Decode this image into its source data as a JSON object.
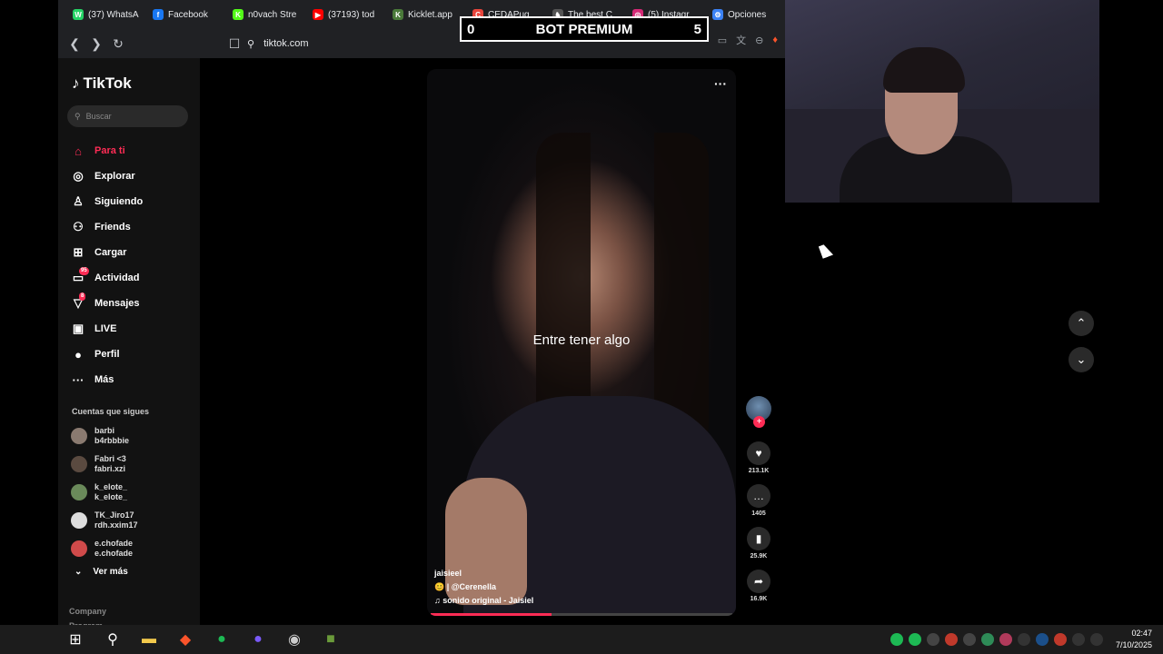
{
  "browser": {
    "tabs": [
      {
        "label": "(37) WhatsA",
        "color": "#25d366",
        "glyph": "W"
      },
      {
        "label": "Facebook",
        "color": "#1877f2",
        "glyph": "f"
      },
      {
        "label": "n0vach Stre",
        "color": "#53fc18",
        "glyph": "K"
      },
      {
        "label": "(37193) tod",
        "color": "#ff0000",
        "glyph": "▶"
      },
      {
        "label": "Kicklet.app",
        "color": "#4a7a3a",
        "glyph": "K"
      },
      {
        "label": "CEDAPug",
        "color": "#e8453c",
        "glyph": "C"
      },
      {
        "label": "The best C",
        "color": "#555555",
        "glyph": "♞"
      },
      {
        "label": "(5) Instagr",
        "color": "#d62976",
        "glyph": "◎"
      },
      {
        "label": "Opciones",
        "color": "#3b82f6",
        "glyph": "⚙"
      }
    ],
    "url": "tiktok.com"
  },
  "overlay": {
    "left_score": "0",
    "title": "BOT PREMIUM",
    "right_score": "5"
  },
  "tiktok": {
    "logo": "TikTok",
    "search_placeholder": "Buscar",
    "nav": [
      {
        "label": "Para ti",
        "icon": "home-icon",
        "glyph": "⌂",
        "active": true,
        "badge": ""
      },
      {
        "label": "Explorar",
        "icon": "compass-icon",
        "glyph": "◎",
        "active": false,
        "badge": ""
      },
      {
        "label": "Siguiendo",
        "icon": "following-icon",
        "glyph": "♙",
        "active": false,
        "badge": ""
      },
      {
        "label": "Friends",
        "icon": "friends-icon",
        "glyph": "⚇",
        "active": false,
        "badge": ""
      },
      {
        "label": "Cargar",
        "icon": "upload-icon",
        "glyph": "⊞",
        "active": false,
        "badge": ""
      },
      {
        "label": "Actividad",
        "icon": "activity-icon",
        "glyph": "▭",
        "active": false,
        "badge": "95"
      },
      {
        "label": "Mensajes",
        "icon": "messages-icon",
        "glyph": "▽",
        "active": false,
        "badge": "8"
      },
      {
        "label": "LIVE",
        "icon": "live-icon",
        "glyph": "▣",
        "active": false,
        "badge": ""
      },
      {
        "label": "Perfil",
        "icon": "profile-icon",
        "glyph": "●",
        "active": false,
        "badge": ""
      },
      {
        "label": "Más",
        "icon": "more-icon",
        "glyph": "···",
        "active": false,
        "badge": ""
      }
    ],
    "following_title": "Cuentas que sigues",
    "following": [
      {
        "name": "barbi",
        "handle": "b4rbbbie",
        "color": "#8a7a70"
      },
      {
        "name": "Fabri <3",
        "handle": "fabri.xzi",
        "color": "#5a4a40"
      },
      {
        "name": "k_elote_",
        "handle": "k_elote_",
        "color": "#6a8a5a"
      },
      {
        "name": "TK_Jiro17",
        "handle": "rdh.xxim17",
        "color": "#dddddd"
      },
      {
        "name": "e.chofade",
        "handle": "e.chofade",
        "color": "#d04a4a"
      }
    ],
    "see_more": "Ver más",
    "company": "Company",
    "program": "Program"
  },
  "video": {
    "caption": "Entre tener algo",
    "author": "jaisieel",
    "description": "| @Cerenella",
    "sound": "sonido original - Jaisiel",
    "progress": 0.4,
    "likes": "213.1K",
    "comments": "1405",
    "saves": "25.9K",
    "shares": "16.9K"
  },
  "taskbar": {
    "time": "02:47",
    "date": "7/10/2025"
  }
}
